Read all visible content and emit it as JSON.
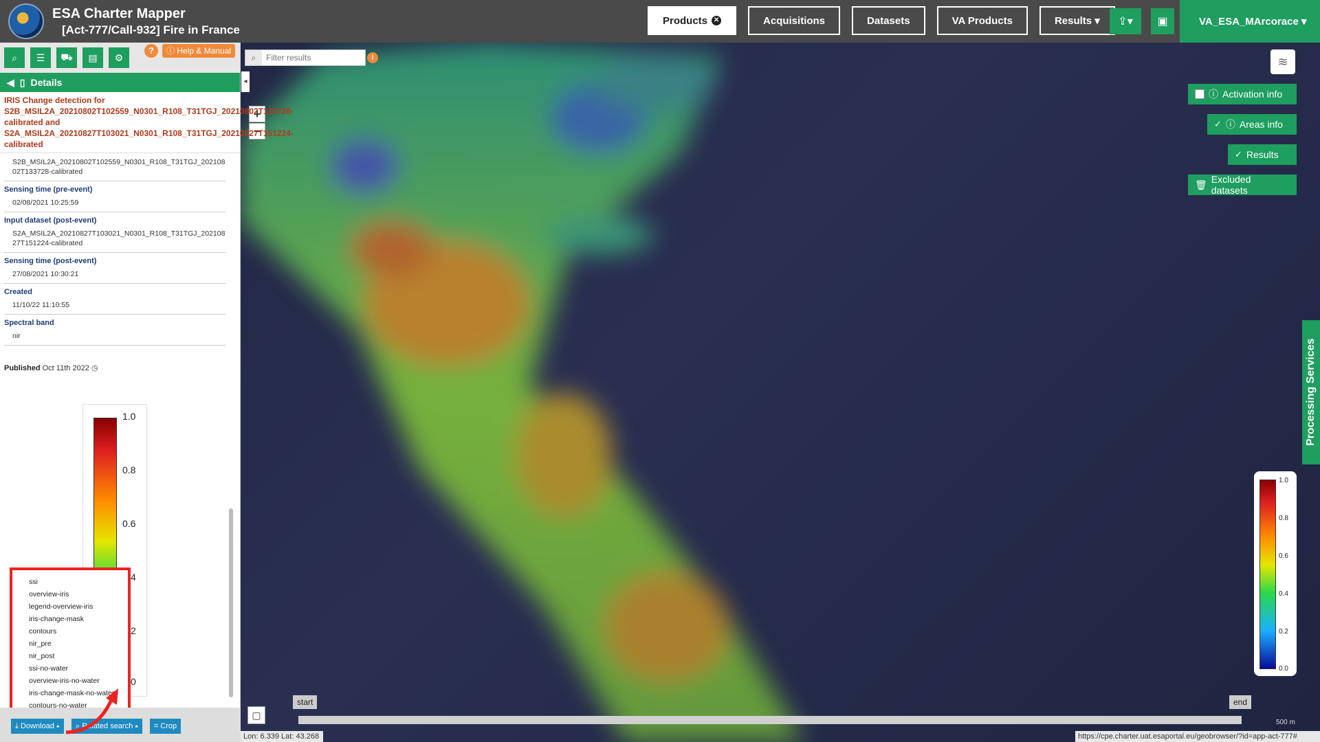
{
  "app": {
    "title": "ESA Charter Mapper",
    "subtitle": "[Act-777/Call-932] Fire in France"
  },
  "nav": {
    "products": "Products",
    "acquisitions": "Acquisitions",
    "datasets": "Datasets",
    "va_products": "VA Products",
    "results": "Results ▾"
  },
  "user": {
    "name": "VA_ESA_MArcorace ▾"
  },
  "panel": {
    "help": "Help & Manual",
    "details": "Details",
    "product_title": "IRIS Change detection for S2B_MSIL2A_20210802T102559_N0301_R108_T31TGJ_20210802T133728-calibrated and S2A_MSIL2A_20210827T103021_N0301_R108_T31TGJ_20210827T151224-calibrated",
    "fields": [
      {
        "label": "",
        "value": "S2B_MSIL2A_20210802T102559_N0301_R108_T31TGJ_20210802T133728-calibrated"
      },
      {
        "label": "Sensing time (pre-event)",
        "value": "02/08/2021 10:25:59"
      },
      {
        "label": "Input dataset (post-event)",
        "value": "S2A_MSIL2A_20210827T103021_N0301_R108_T31TGJ_20210827T151224-calibrated"
      },
      {
        "label": "Sensing time (post-event)",
        "value": "27/08/2021 10:30:21"
      },
      {
        "label": "Created",
        "value": "11/10/22 11:10:55"
      },
      {
        "label": "Spectral band",
        "value": "nir"
      }
    ],
    "published_label": "Published",
    "published_value": "Oct 11th 2022",
    "legend_ticks": [
      "1.0",
      "0.8",
      "0.6",
      "4",
      "2",
      "0"
    ],
    "dropdown_items": [
      "ssi",
      "overview-iris",
      "legend-overview-iris",
      "iris-change-mask",
      "contours",
      "nir_pre",
      "nir_post",
      "ssi-no-water",
      "overview-iris-no-water",
      "iris-change-mask-no-water",
      "contours-no-water"
    ],
    "download": "Download ▴",
    "related_search": "Related search ▴",
    "crop": "Crop"
  },
  "map": {
    "filter_placeholder": "Filter results",
    "activation_info": "Activation info",
    "areas_info": "Areas info",
    "results": "Results",
    "excluded_datasets": "Excluded datasets",
    "processing_services": "Processing Services",
    "legend_ticks": [
      "1.0",
      "0.8",
      "0.6",
      "0.4",
      "0.2",
      "0.0"
    ],
    "timeline_start": "start",
    "timeline_end": "end",
    "coords": "Lon: 6.339 Lat: 43.268",
    "url": "https://cpe.charter.uat.esaportal.eu/geobrowser/?id=app-act-777#",
    "scale": "500 m"
  }
}
